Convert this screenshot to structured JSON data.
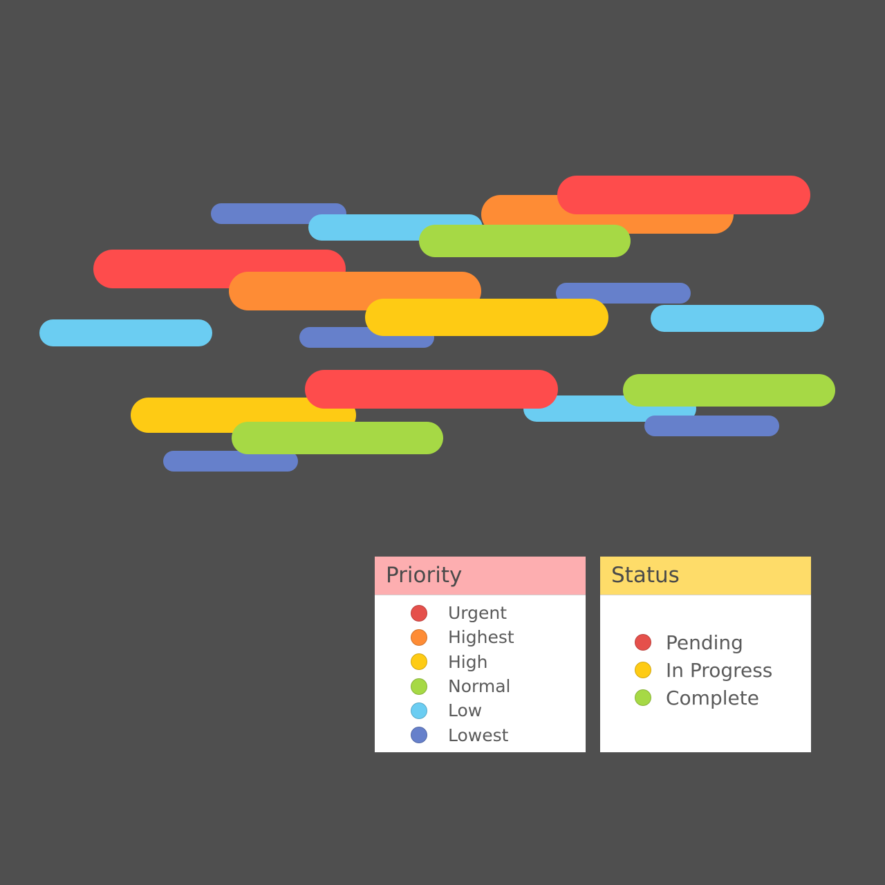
{
  "colors": {
    "background": "#4f4f4f",
    "urgent": "#fe4c4c",
    "highest": "#fe8c35",
    "high": "#fecb14",
    "normal": "#a6d945",
    "low": "#6bcdf2",
    "lowest": "#6680cb"
  },
  "legend": {
    "priority": {
      "title": "Priority",
      "items": [
        {
          "label": "Urgent",
          "color": "#e5504b"
        },
        {
          "label": "Highest",
          "color": "#fe8c35"
        },
        {
          "label": "High",
          "color": "#fecb14"
        },
        {
          "label": "Normal",
          "color": "#a6d945"
        },
        {
          "label": "Low",
          "color": "#6bcdf2"
        },
        {
          "label": "Lowest",
          "color": "#6680cb"
        }
      ]
    },
    "status": {
      "title": "Status",
      "items": [
        {
          "label": "Pending",
          "color": "#e5504b"
        },
        {
          "label": "In Progress",
          "color": "#fecb14"
        },
        {
          "label": "Complete",
          "color": "#a6d945"
        }
      ]
    }
  },
  "bars": [
    {
      "priority": "lowest"
    },
    {
      "priority": "low"
    },
    {
      "priority": "highest"
    },
    {
      "priority": "urgent"
    },
    {
      "priority": "normal"
    },
    {
      "priority": "urgent"
    },
    {
      "priority": "highest"
    },
    {
      "priority": "lowest"
    },
    {
      "priority": "low"
    },
    {
      "priority": "lowest"
    },
    {
      "priority": "high"
    },
    {
      "priority": "low"
    },
    {
      "priority": "yellow_high"
    },
    {
      "priority": "lowest"
    },
    {
      "priority": "normal"
    },
    {
      "priority": "low"
    },
    {
      "priority": "urgent"
    },
    {
      "priority": "lowest"
    },
    {
      "priority": "normal"
    }
  ]
}
